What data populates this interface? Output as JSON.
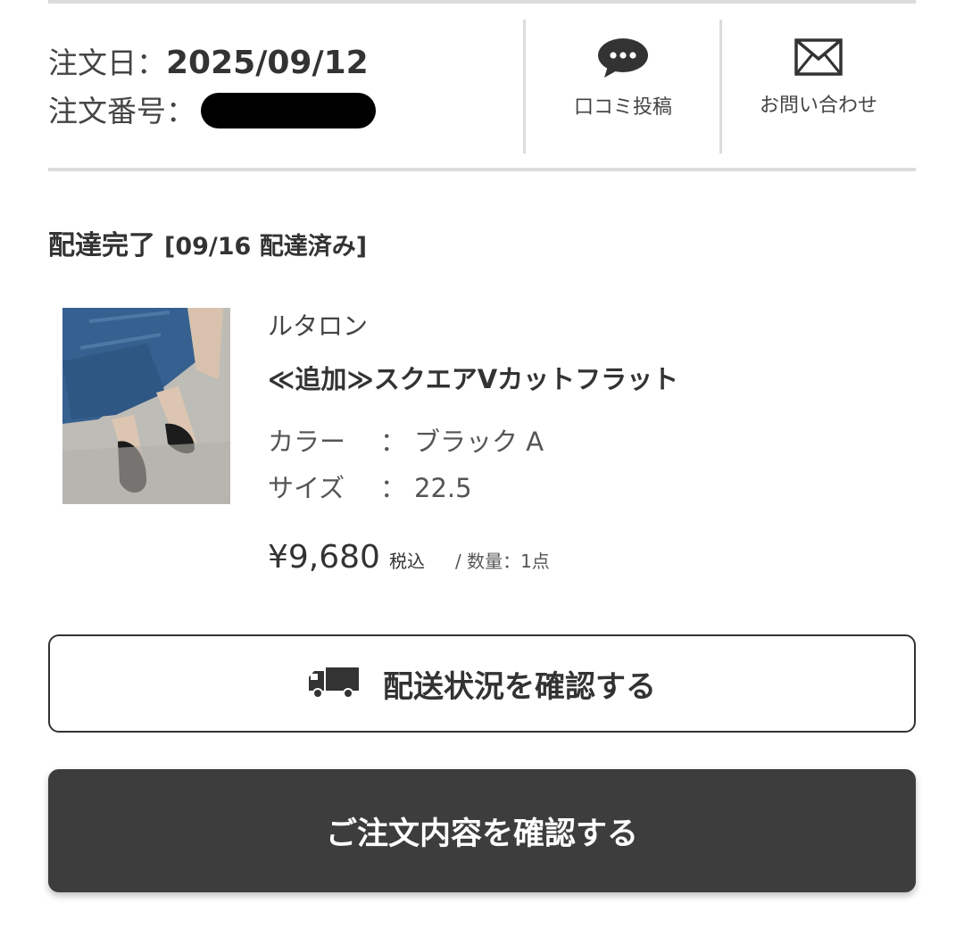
{
  "order": {
    "date_label": "注文日：",
    "date_value": "2025/09/12",
    "number_label": "注文番号："
  },
  "actions": {
    "review_label": "口コミ投稿",
    "review_icon": "chat-bubble-icon",
    "contact_label": "お問い合わせ",
    "contact_icon": "envelope-icon"
  },
  "status": {
    "title": "配達完了",
    "detail": "[09/16 配達済み]"
  },
  "item": {
    "brand": "ルタロン",
    "name": "≪追加≫スクエアVカットフラット",
    "color_label": "カラー",
    "color_value": "ブラック A",
    "size_label": "サイズ",
    "size_value": "22.5",
    "separator": "：",
    "price": "¥9,680",
    "tax": "税込",
    "quantity": "/ 数量：1点"
  },
  "buttons": {
    "delivery_status": "配送状況を確認する",
    "delivery_icon": "truck-icon",
    "order_details": "ご注文内容を確認する"
  }
}
